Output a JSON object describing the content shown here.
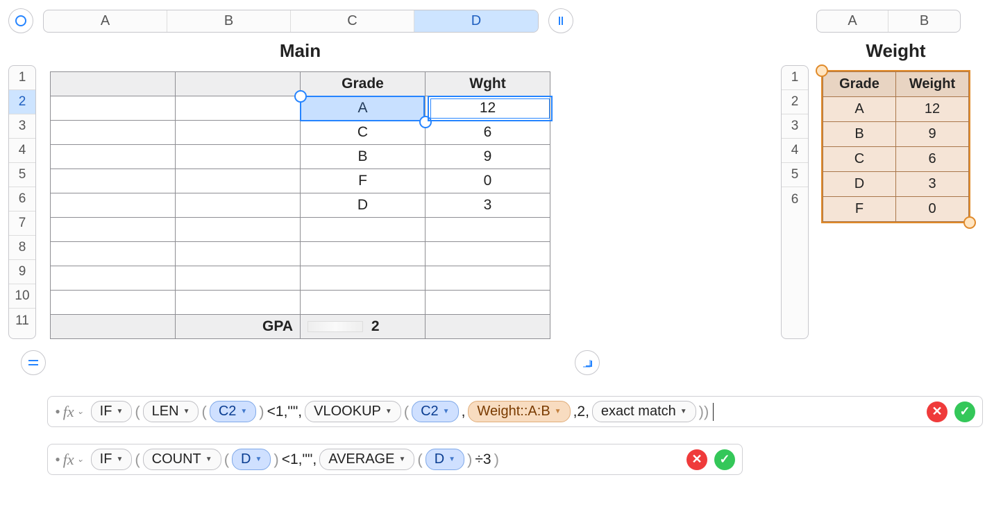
{
  "main": {
    "title": "Main",
    "columns": [
      "A",
      "B",
      "C",
      "D"
    ],
    "selected_column_index": 3,
    "rows": [
      "1",
      "2",
      "3",
      "4",
      "5",
      "6",
      "7",
      "8",
      "9",
      "10",
      "11"
    ],
    "selected_row_index": 1,
    "header": {
      "c": "Grade",
      "d": "Wght"
    },
    "data": [
      {
        "c": "A",
        "d": "12"
      },
      {
        "c": "C",
        "d": "6"
      },
      {
        "c": "B",
        "d": "9"
      },
      {
        "c": "F",
        "d": "0"
      },
      {
        "c": "D",
        "d": "3"
      }
    ],
    "footer": {
      "label": "GPA",
      "value": "2"
    }
  },
  "weight": {
    "title": "Weight",
    "columns": [
      "A",
      "B"
    ],
    "rows": [
      "1",
      "2",
      "3",
      "4",
      "5",
      "6"
    ],
    "header": {
      "a": "Grade",
      "b": "Weight"
    },
    "data": [
      {
        "a": "A",
        "b": "12"
      },
      {
        "a": "B",
        "b": "9"
      },
      {
        "a": "C",
        "b": "6"
      },
      {
        "a": "D",
        "b": "3"
      },
      {
        "a": "F",
        "b": "0"
      }
    ]
  },
  "formula1": {
    "if": "IF",
    "len": "LEN",
    "c2": "C2",
    "lt": "<1,\"\",",
    "vlookup": "VLOOKUP",
    "c2b": "C2",
    "range": "Weight::A:B",
    "two": ",2,",
    "match": "exact match",
    "comma": ","
  },
  "formula2": {
    "if": "IF",
    "count": "COUNT",
    "d1": "D",
    "lt": "<1,\"\",",
    "avg": "AVERAGE",
    "d2": "D",
    "div": "÷3"
  }
}
